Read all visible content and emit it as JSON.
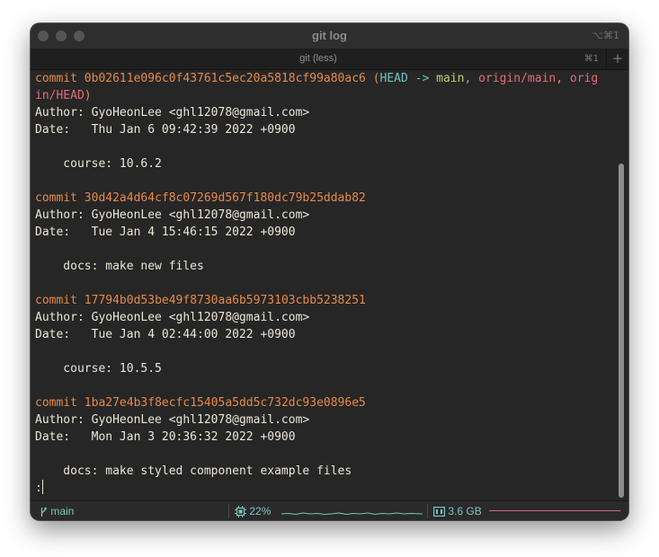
{
  "window": {
    "title": "git log",
    "title_shortcut": "⌥⌘1"
  },
  "tabbar": {
    "tab_label": "git (less)",
    "tab_shortcut": "⌘1",
    "new_tab_label": "+"
  },
  "terminal": {
    "commits": [
      {
        "word": "commit",
        "hash": "0b02611e096c0f43761c5ec20a5818cf99a80ac6",
        "refs": {
          "open": " (",
          "head": "HEAD -> ",
          "main": "main",
          "sep1": ", ",
          "origin_main": "origin/main",
          "sep2": ", ",
          "origin_head_part1": "orig",
          "origin_head_part2": "in/HEAD",
          "close": ")"
        },
        "author": "Author: GyoHeonLee <ghl12078@gmail.com>",
        "date": "Date:   Thu Jan 6 09:42:39 2022 +0900",
        "message": "    course: 10.6.2"
      },
      {
        "word": "commit",
        "hash": "30d42a4d64cf8c07269d567f180dc79b25ddab82",
        "author": "Author: GyoHeonLee <ghl12078@gmail.com>",
        "date": "Date:   Tue Jan 4 15:46:15 2022 +0900",
        "message": "    docs: make new files"
      },
      {
        "word": "commit",
        "hash": "17794b0d53be49f8730aa6b5973103cbb5238251",
        "author": "Author: GyoHeonLee <ghl12078@gmail.com>",
        "date": "Date:   Tue Jan 4 02:44:00 2022 +0900",
        "message": "    course: 10.5.5"
      },
      {
        "word": "commit",
        "hash": "1ba27e4b3f8ecfc15405a5dd5c732dc93e0896e5",
        "author": "Author: GyoHeonLee <ghl12078@gmail.com>",
        "date": "Date:   Mon Jan 3 20:36:32 2022 +0900",
        "message": "    docs: make styled component example files"
      }
    ],
    "prompt": ":"
  },
  "statusbar": {
    "branch": "main",
    "cpu": "22%",
    "memory": "3.6 GB"
  },
  "colors": {
    "commit_hash": "#e68a4a",
    "head_ref": "#6cc4c2",
    "branch_ref": "#b8d36e",
    "remote_ref": "#e36c78",
    "status_text": "#7ec4c3",
    "memory_graph": "#d06a87"
  },
  "icons": {
    "branch": "git-branch-icon",
    "cpu": "cpu-chip-icon",
    "memory": "memory-module-icon",
    "new_tab": "plus-icon"
  }
}
